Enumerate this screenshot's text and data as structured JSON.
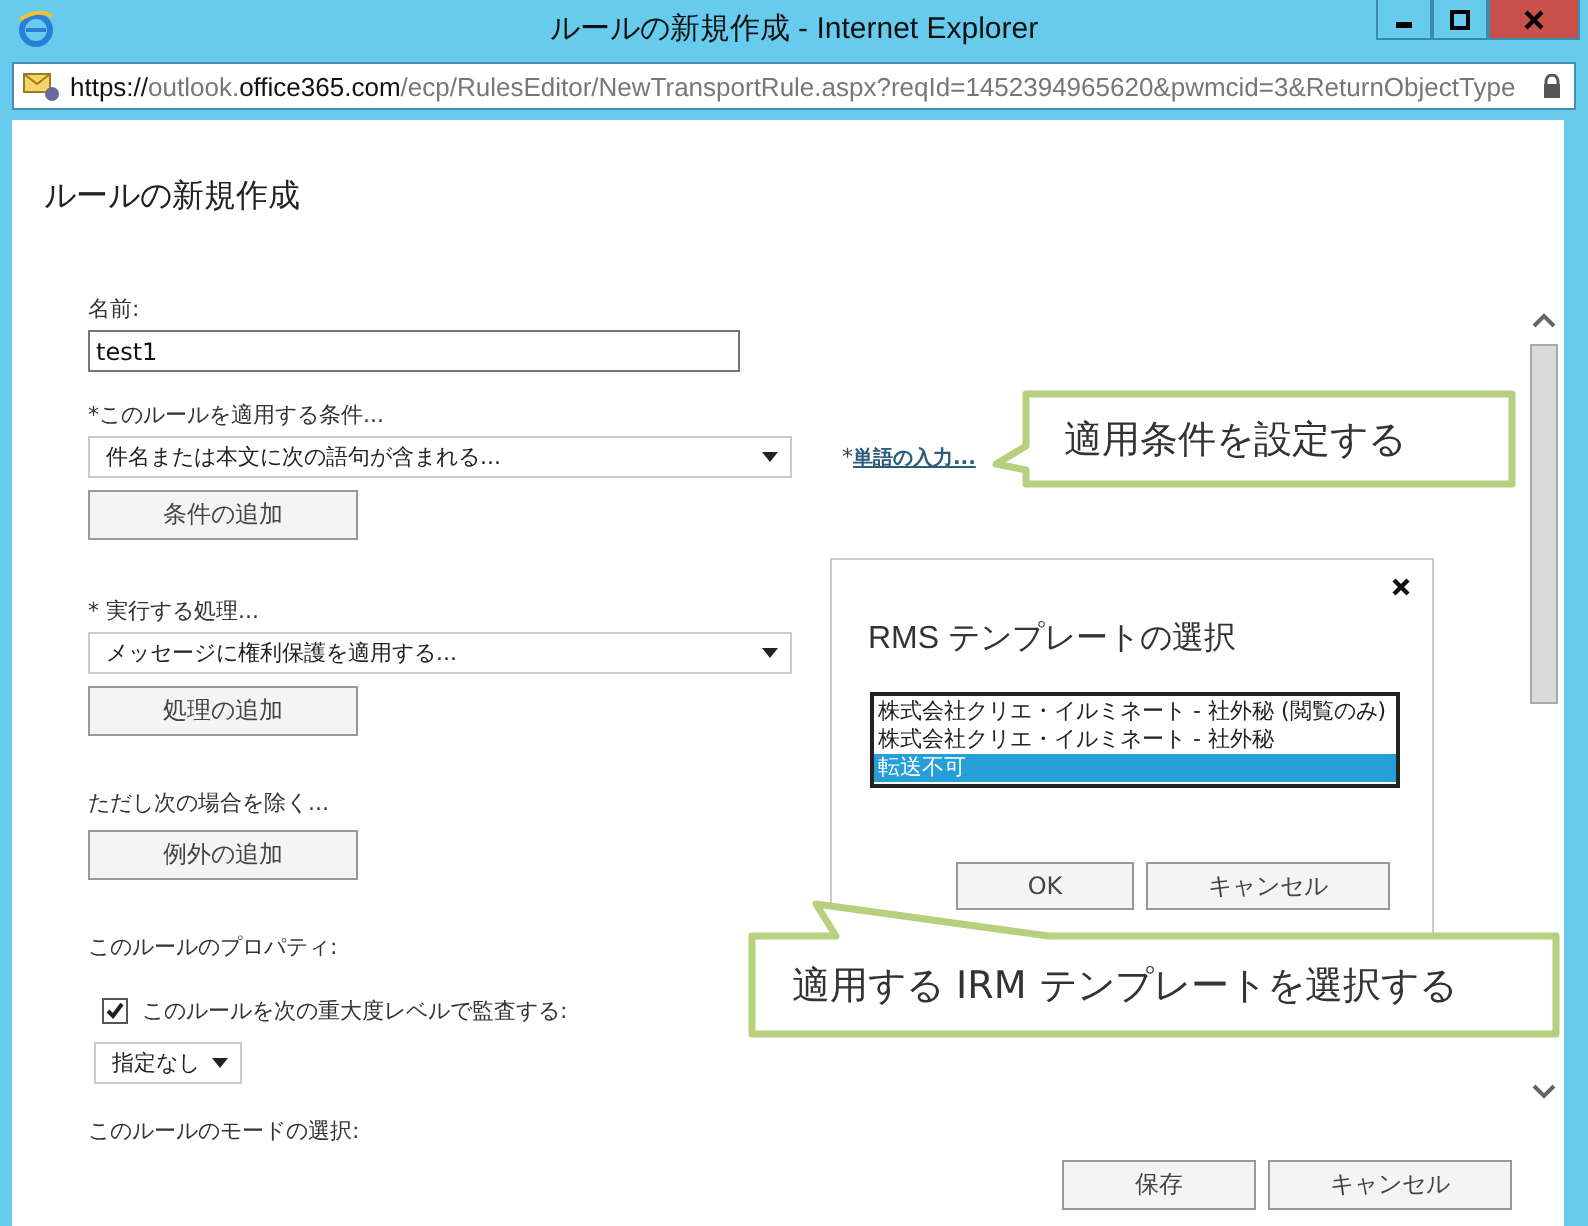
{
  "window": {
    "title": "ルールの新規作成 - Internet Explorer"
  },
  "address_bar": {
    "url_segments": [
      {
        "text": "https://",
        "highlight": true
      },
      {
        "text": "outlook.",
        "highlight": false
      },
      {
        "text": "office365.com",
        "highlight": true
      },
      {
        "text": "/ecp/RulesEditor/NewTransportRule.aspx?reqId=1452394965620&pwmcid=3&ReturnObjectType",
        "highlight": false
      }
    ]
  },
  "page_title": "ルールの新規作成",
  "form": {
    "name_label": "名前:",
    "name_value": "test1",
    "condition_label": "*このルールを適用する条件...",
    "condition_value": "件名または本文に次の語句が含まれる...",
    "condition_link_prefix": "*",
    "condition_link": "単語の入力...",
    "add_condition": "条件の追加",
    "action_label": "* 実行する処理...",
    "action_value": "メッセージに権利保護を適用する...",
    "add_action": "処理の追加",
    "exception_label": "ただし次の場合を除く...",
    "add_exception": "例外の追加",
    "properties_label": "このルールのプロパティ:",
    "audit": {
      "label": "このルールを次の重大度レベルで監査する:",
      "checked": true
    },
    "severity_value": "指定なし",
    "mode_label": "このルールのモードの選択:"
  },
  "footer_buttons": [
    "保存",
    "キャンセル"
  ],
  "dialog": {
    "title": "RMS テンプレートの選択",
    "templates": [
      {
        "label": "株式会社クリエ・イルミネート - 社外秘 (閲覧のみ)",
        "selected": false
      },
      {
        "label": "株式会社クリエ・イルミネート - 社外秘",
        "selected": false
      },
      {
        "label": "転送不可",
        "selected": true
      }
    ],
    "buttons": [
      "OK",
      "キャンセル"
    ]
  },
  "callouts": [
    "適用条件を設定する",
    "適用する IRM テンプレートを選択する"
  ]
}
